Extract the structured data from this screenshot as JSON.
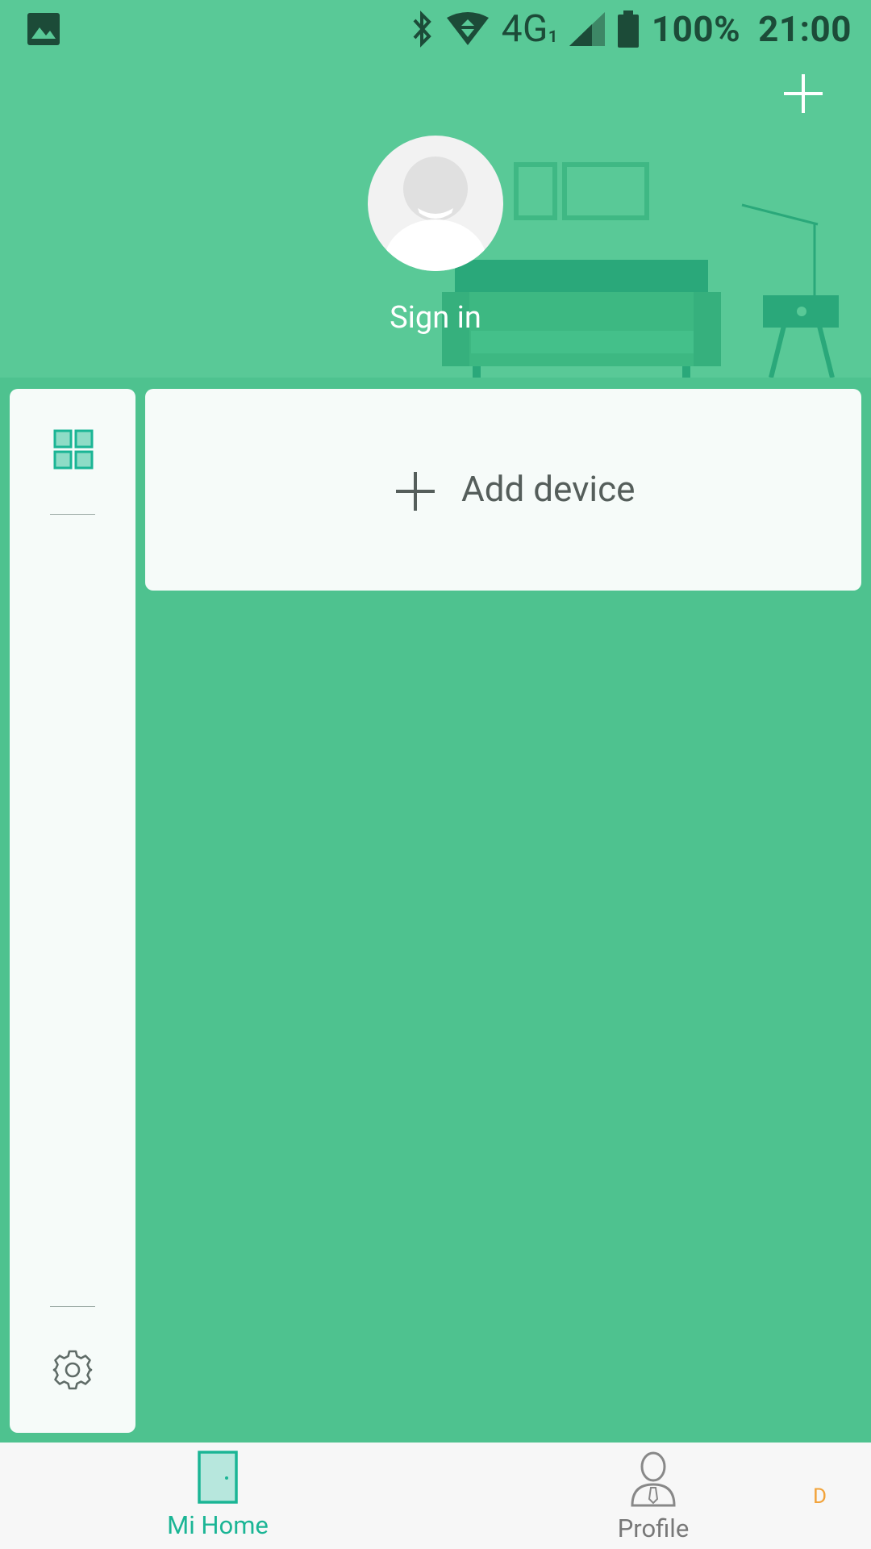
{
  "status_bar": {
    "network": "4G",
    "sim_slot": "1",
    "battery": "100%",
    "time": "21:00"
  },
  "header": {
    "sign_in": "Sign in"
  },
  "main": {
    "add_device_label": "Add device"
  },
  "bottom_nav": {
    "items": [
      {
        "label": "Mi Home",
        "icon": "door-icon",
        "active": true
      },
      {
        "label": "Profile",
        "icon": "person-icon",
        "active": false
      }
    ],
    "badge": "D"
  },
  "colors": {
    "background": "#4ec28f",
    "header": "#59c997",
    "accent": "#1bb595",
    "card": "#f6fbf9"
  }
}
